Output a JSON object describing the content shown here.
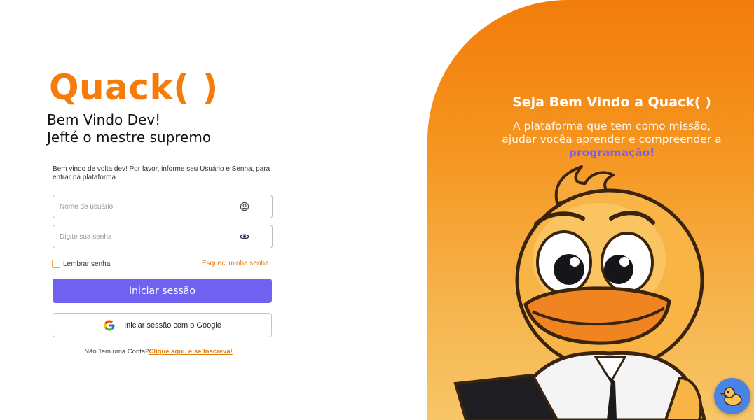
{
  "brand": {
    "logo": "Quack( )"
  },
  "login": {
    "welcome_line1": "Bem Vindo Dev!",
    "welcome_line2": "Jefté o mestre supremo",
    "subtext": "Bem vindo de volta dev! Por favor, informe seu Usuário e Senha, para entrar na plataforma",
    "username_placeholder": "Nome de usuário",
    "username_icon": "user-circle-icon",
    "password_placeholder": "Digite sua senha",
    "password_icon": "eye-icon",
    "remember_label": "Lembrar senha",
    "forgot_label": "Esqueci minha senha",
    "submit_label": "Iniciar sessão",
    "google_label": "Iniciar sessão com o Google",
    "signup_prefix": "Não Tem uma Conta?",
    "signup_link": "Clique aqui, e se Inscreva!"
  },
  "hero": {
    "title_prefix": "Seja Bem Vindo a ",
    "title_brand": "Quack( )",
    "desc_main": "A plataforma que tem como missão, ajudar vocêa aprender e compreender a ",
    "desc_highlight": "programação!"
  },
  "colors": {
    "accent_orange": "#f57c0a",
    "primary_button": "#7161f0",
    "link_orange": "#e07b12",
    "highlight_purple": "#7b5cf5",
    "fab_blue": "#4a83e3"
  },
  "fab": {
    "icon": "duck-icon"
  }
}
